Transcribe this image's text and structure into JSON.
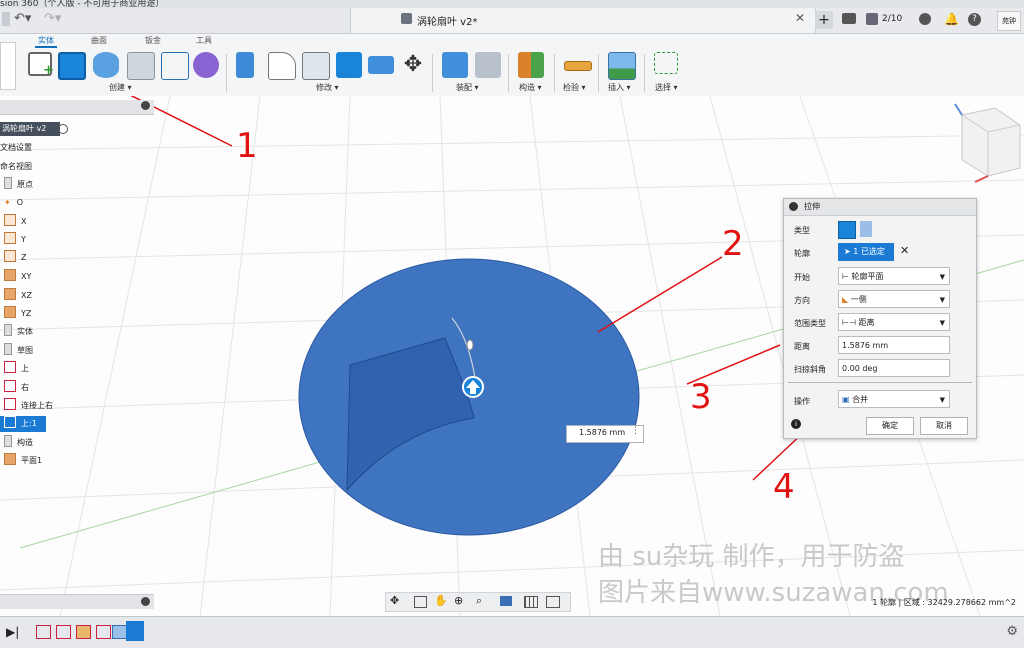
{
  "window": {
    "title_partial": "sion 360（个人版 - 不可用于商业用途）"
  },
  "document": {
    "name": "涡轮扇叶 v2*"
  },
  "header_right": {
    "jobs_label": "2/10",
    "user_initials": "苑钟"
  },
  "toolbar": {
    "tabs": [
      "实体",
      "曲面",
      "钣金",
      "工具"
    ],
    "active_tab": "实体",
    "groups": {
      "create": "创建 ▾",
      "modify": "修改 ▾",
      "assemble": "装配 ▾",
      "construct": "构造 ▾",
      "inspect": "检验 ▾",
      "insert": "插入 ▾",
      "select": "选择 ▾"
    }
  },
  "browser": {
    "root": "涡轮扇叶 v2",
    "items": [
      "文档设置",
      "命名视图",
      "原点",
      "O",
      "X",
      "Y",
      "Z",
      "XY",
      "XZ",
      "YZ",
      "实体",
      "草图",
      "上",
      "右",
      "连接上右",
      "上:1",
      "构造",
      "平面1"
    ],
    "selected": "上:1"
  },
  "canvas": {
    "distance_value": "1.5876 mm"
  },
  "extrude_dialog": {
    "title": "拉伸",
    "type_label": "类型",
    "profile_label": "轮廓",
    "profile_value": "1 已选定",
    "start_label": "开始",
    "start_value": "轮廓平面",
    "direction_label": "方向",
    "direction_value": "一侧",
    "extent_label": "范围类型",
    "extent_value": "距离",
    "distance_label": "距离",
    "distance_value": "1.5876 mm",
    "taper_label": "扫掠斜角",
    "taper_value": "0.00 deg",
    "operation_label": "操作",
    "operation_value": "合并",
    "ok_label": "确定",
    "cancel_label": "取消"
  },
  "annotations": [
    "1",
    "2",
    "3",
    "4"
  ],
  "watermark": {
    "line1": "由 su杂玩 制作，用于防盗",
    "line2": "图片来自www.suzawan.com"
  },
  "status": {
    "text": "1 轮廓 | 区域 : 32429.278662 mm^2"
  },
  "colors": {
    "accent": "#0f6fbf",
    "body_blue": "#3f74c1",
    "annotation_red": "#e01212"
  }
}
